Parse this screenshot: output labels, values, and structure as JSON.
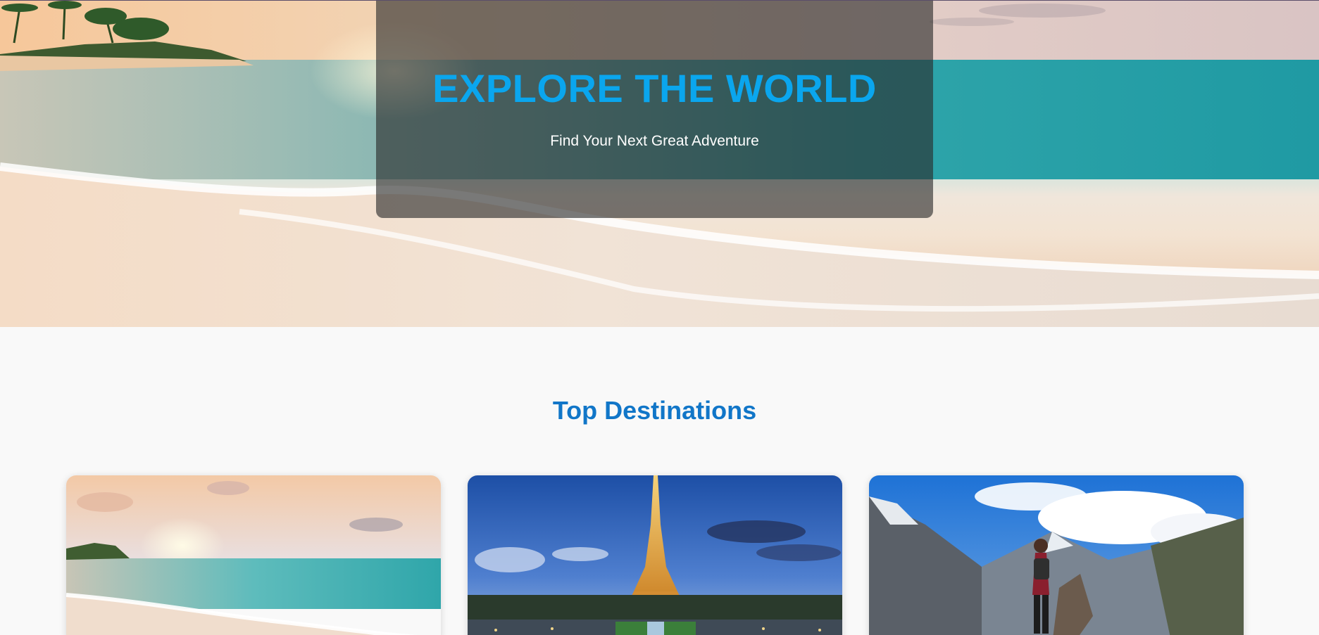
{
  "hero": {
    "title": "EXPLORE THE WORLD",
    "subtitle": "Find Your Next Great Adventure"
  },
  "destinations": {
    "heading": "Top Destinations",
    "cards": [
      {
        "image": "tropical-beach-sunset"
      },
      {
        "image": "eiffel-tower-paris"
      },
      {
        "image": "himalaya-mountain-hiker"
      }
    ]
  }
}
